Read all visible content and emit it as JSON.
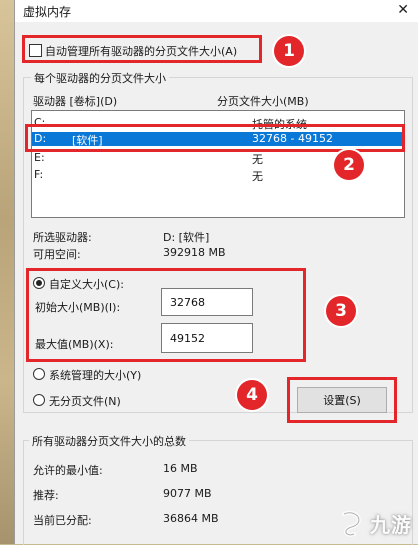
{
  "window": {
    "title": "虚拟内存",
    "close_glyph": "✕"
  },
  "auto_manage": {
    "label": "自动管理所有驱动器的分页文件大小(A)",
    "checked": false
  },
  "per_drive_group": {
    "title": "每个驱动器的分页文件大小",
    "columns": [
      "驱动器 [卷标](D)",
      "分页文件大小(MB)"
    ],
    "rows": [
      {
        "drive": "C:",
        "label": "",
        "size": "托管的系统"
      },
      {
        "drive": "D:",
        "label": "[软件]",
        "size": "32768 - 49152",
        "selected": true
      },
      {
        "drive": "E:",
        "label": "",
        "size": "无"
      },
      {
        "drive": "F:",
        "label": "",
        "size": "无"
      }
    ],
    "selected_drive_label": "所选驱动器:",
    "selected_drive_value": "D:  [软件]",
    "free_space_label": "可用空间:",
    "free_space_value": "392918 MB",
    "custom_size": {
      "label": "自定义大小(C):",
      "checked": true
    },
    "initial_size": {
      "label": "初始大小(MB)(I):",
      "value": "32768"
    },
    "max_size": {
      "label": "最大值(MB)(X):",
      "value": "49152"
    },
    "system_managed": {
      "label": "系统管理的大小(Y)",
      "checked": false
    },
    "no_paging": {
      "label": "无分页文件(N)",
      "checked": false
    },
    "set_button": "设置(S)"
  },
  "total_group": {
    "title": "所有驱动器分页文件大小的总数",
    "min_allowed_label": "允许的最小值:",
    "min_allowed_value": "16 MB",
    "recommended_label": "推荐:",
    "recommended_value": "9077 MB",
    "current_label": "当前已分配:",
    "current_value": "36864 MB"
  },
  "annotations": [
    "1",
    "2",
    "3",
    "4"
  ],
  "watermark": {
    "text": "九游"
  },
  "colors": {
    "callout": "#e3262a",
    "selection": "#0a78d7"
  }
}
